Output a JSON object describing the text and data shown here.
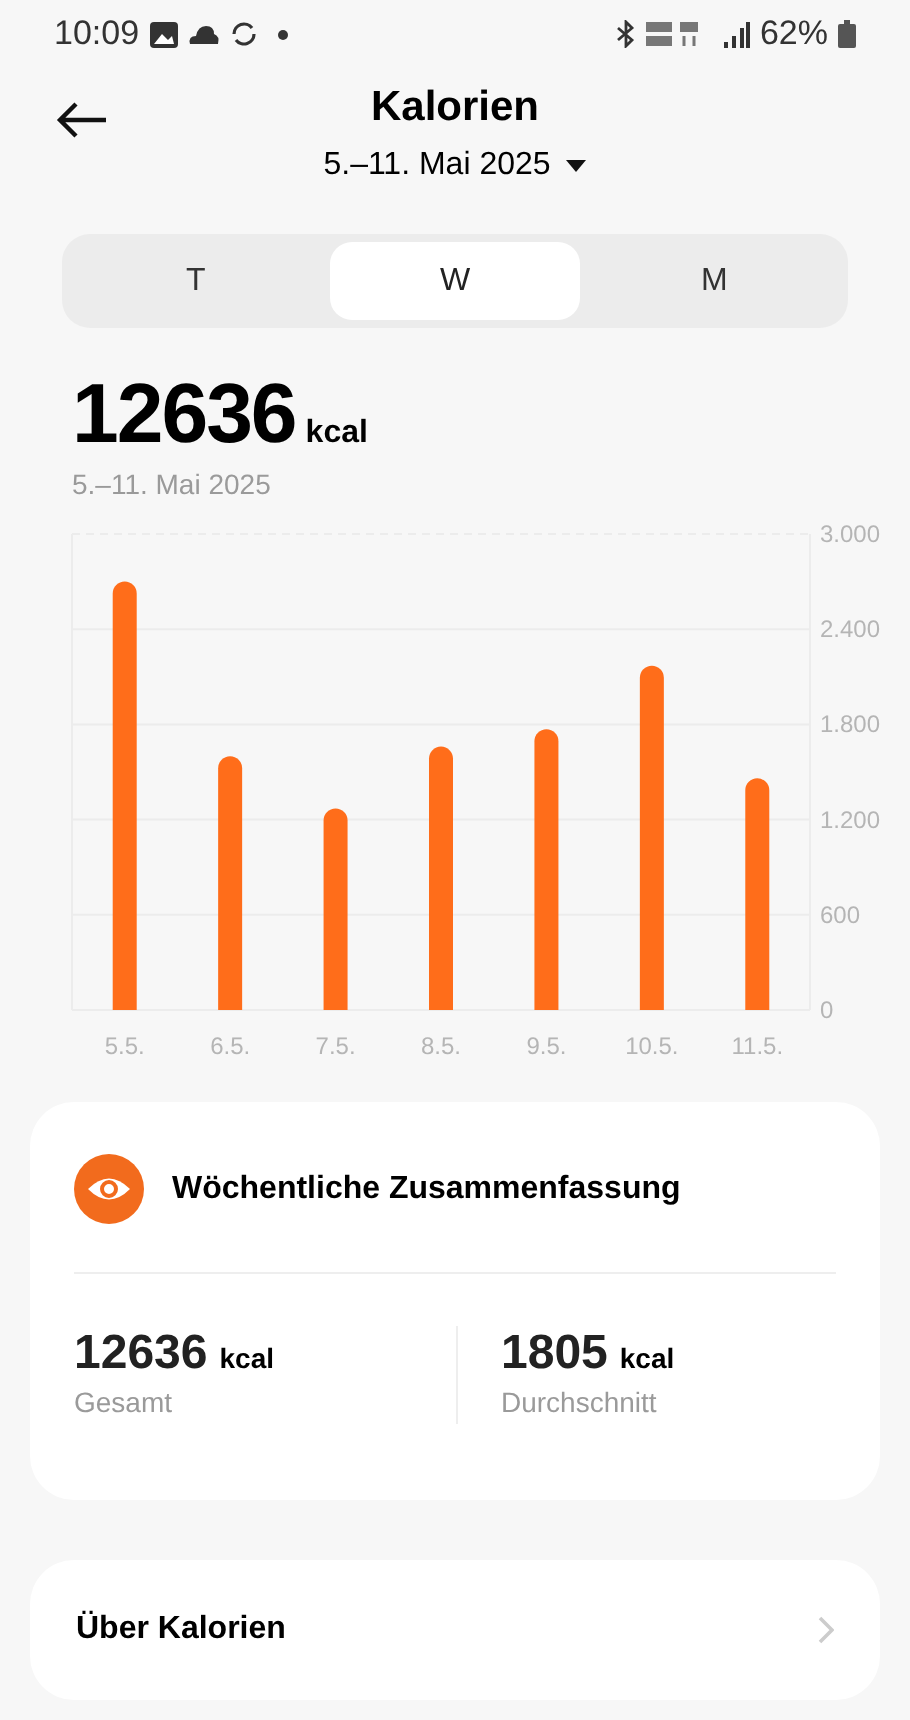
{
  "status_bar": {
    "time": "10:09",
    "battery": "62%"
  },
  "header": {
    "title": "Kalorien",
    "period": "5.–11. Mai 2025"
  },
  "tabs": [
    {
      "label": "T",
      "selected": false
    },
    {
      "label": "W",
      "selected": true
    },
    {
      "label": "M",
      "selected": false
    }
  ],
  "summary": {
    "value": "12636",
    "unit": "kcal",
    "period": "5.–11. Mai 2025"
  },
  "chart_data": {
    "type": "bar",
    "categories": [
      "5.5.",
      "6.5.",
      "7.5.",
      "8.5.",
      "9.5.",
      "10.5.",
      "11.5."
    ],
    "series": [
      {
        "color": "#ff6d1a",
        "values": [
          2700,
          1600,
          1270,
          1660,
          1770,
          2170,
          1460
        ]
      }
    ],
    "grid": true,
    "ylim": [
      0,
      3000
    ],
    "yticks": [
      {
        "value": 0,
        "label": "0"
      },
      {
        "value": 600,
        "label": "600"
      },
      {
        "value": 1200,
        "label": "1.200"
      },
      {
        "value": 1800,
        "label": "1.800"
      },
      {
        "value": 2400,
        "label": "2.400"
      },
      {
        "value": 3000,
        "label": "3.000"
      }
    ]
  },
  "weekly_summary": {
    "title": "Wöchentliche Zusammenfassung",
    "stats": [
      {
        "value": "12636",
        "unit": "kcal",
        "label": "Gesamt"
      },
      {
        "value": "1805",
        "unit": "kcal",
        "label": "Durchschnitt"
      }
    ]
  },
  "about": {
    "label": "Über Kalorien"
  }
}
